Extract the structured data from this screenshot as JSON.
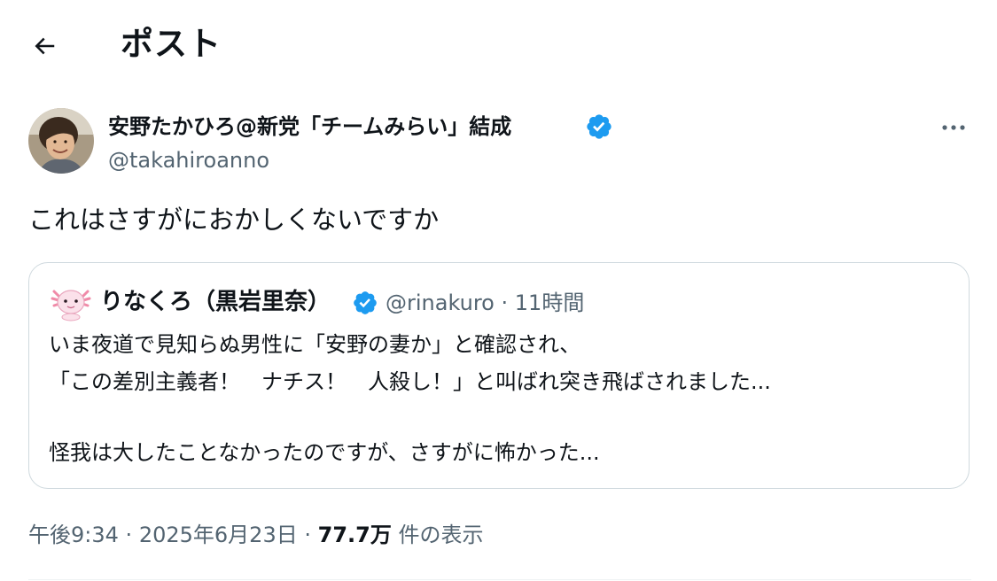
{
  "header": {
    "back_icon": "arrow-left-icon",
    "title": "ポスト"
  },
  "post": {
    "author_name": "安野たかひろ@新党「チームみらい」結成",
    "verified_icon": "verified-badge-icon",
    "handle": "@takahiroanno",
    "more_icon": "more-horizontal-icon",
    "text": "これはさすがにおかしくないですか"
  },
  "quote": {
    "avatar_icon": "axolotl-avatar-icon",
    "author_name": "りなくろ（黒岩里奈）",
    "handle": "@rinakuro",
    "separator": "·",
    "time": "11時間",
    "line1": "いま夜道で見知らぬ男性に「安野の妻か」と確認され、",
    "line2": "「この差別主義者！　ナチス！　人殺し！」と叫ばれ突き飛ばされました...",
    "line3": "怪我は大したことなかったのですが、さすがに怖かった..."
  },
  "meta": {
    "time": "午後9:34",
    "separator": "·",
    "date": "2025年6月23日",
    "views_count": "77.7万",
    "views_label": "件の表示"
  },
  "colors": {
    "text_primary": "#0f1419",
    "text_secondary": "#536471",
    "verified_blue": "#1d9bf0",
    "border": "#cfd9de"
  }
}
